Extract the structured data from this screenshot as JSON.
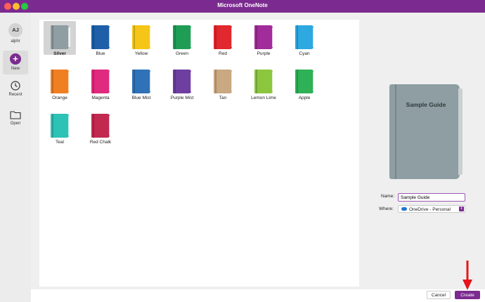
{
  "window": {
    "title": "Microsoft OneNote"
  },
  "sidebar": {
    "avatar_initials": "AJ",
    "user_name": "alphr",
    "items": [
      {
        "label": "New",
        "icon": "plus-circle-icon"
      },
      {
        "label": "Recent",
        "icon": "clock-icon"
      },
      {
        "label": "Open",
        "icon": "folder-icon"
      }
    ]
  },
  "colors": [
    {
      "name": "Silver",
      "hex": "#8e9ea2",
      "selected": true
    },
    {
      "name": "Blue",
      "hex": "#1f5fa8"
    },
    {
      "name": "Yellow",
      "hex": "#f5c518"
    },
    {
      "name": "Green",
      "hex": "#1f9d55"
    },
    {
      "name": "Red",
      "hex": "#e0282e"
    },
    {
      "name": "Purple",
      "hex": "#a12c9a"
    },
    {
      "name": "Cyan",
      "hex": "#2ea8e0"
    },
    {
      "name": "Orange",
      "hex": "#f07f22"
    },
    {
      "name": "Magenta",
      "hex": "#e02a7d"
    },
    {
      "name": "Blue Mist",
      "hex": "#2f72b8"
    },
    {
      "name": "Purple Mist",
      "hex": "#6e3fa0"
    },
    {
      "name": "Tan",
      "hex": "#c9a882"
    },
    {
      "name": "Lemon Lime",
      "hex": "#8cc63f"
    },
    {
      "name": "Apple",
      "hex": "#2eb157"
    },
    {
      "name": "Teal",
      "hex": "#2cc2b5"
    },
    {
      "name": "Red Chalk",
      "hex": "#c2294f"
    }
  ],
  "preview": {
    "title": "Sample Guide"
  },
  "form": {
    "name_label": "Name:",
    "name_value": "Sample Guide",
    "where_label": "Where:",
    "where_value": "OneDrive - Personal"
  },
  "buttons": {
    "cancel": "Cancel",
    "create": "Create"
  },
  "accent": "#7b2b8f"
}
